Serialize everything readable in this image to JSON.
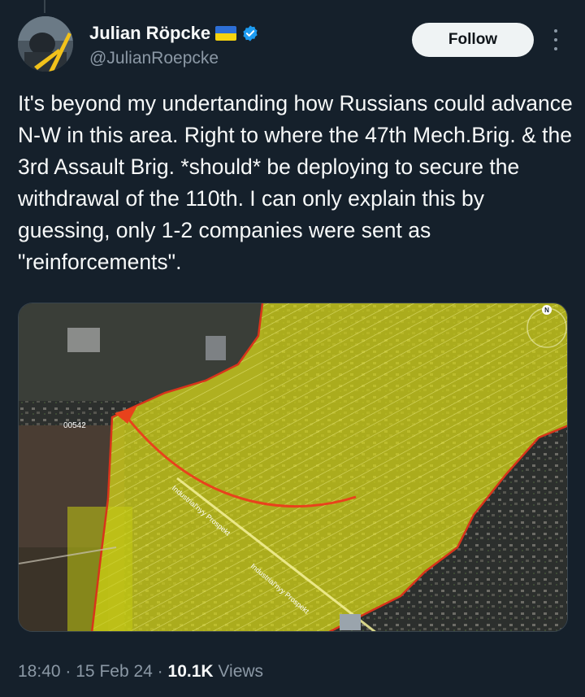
{
  "author": {
    "display_name": "Julian Röpcke",
    "handle": "@JulianRoepcke",
    "avatar_icon": "avatar-photo",
    "flag_icon": "ukraine-flag-icon",
    "verified_icon": "verified-badge-icon"
  },
  "actions": {
    "follow_label": "Follow",
    "more_icon": "more-options-icon"
  },
  "tweet": {
    "text": "It's beyond my undertanding how Russians could advance N-W in this area. Right to where the 47th Mech.Brig. & the 3rd Assault Brig. *should* be deploying to secure the withdrawal of the 110th. I can only explain this by guessing, only 1-2  companies were sent as \"reinforcements\"."
  },
  "media": {
    "type": "satellite-map",
    "labels": {
      "road_code": "00542",
      "street_1": "Industrial'nyy Prospekt",
      "street_2": "Industrial'nyy Prospekt",
      "north_marker": "N"
    },
    "colors": {
      "overlay": "#e6e619",
      "arrow": "#e8421c",
      "border": "#d8341b"
    }
  },
  "meta": {
    "time": "18:40",
    "date": "15 Feb 24",
    "views_count": "10.1K",
    "views_label": "Views",
    "separator": "·"
  },
  "theme": {
    "background": "#15202b",
    "text": "#f7f9f9",
    "secondary": "#8b98a5",
    "verified": "#1d9bf0"
  }
}
